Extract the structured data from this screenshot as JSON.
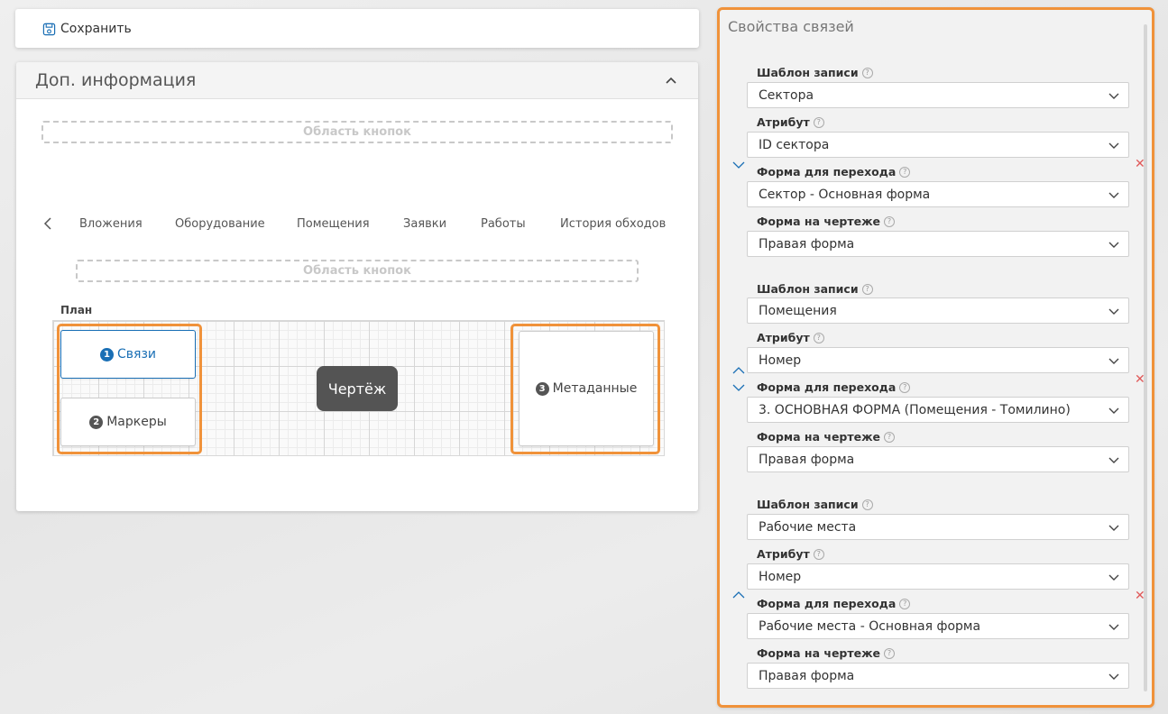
{
  "toolbar": {
    "save_label": "Сохранить"
  },
  "panel": {
    "title": "Доп. информация",
    "button_area_label": "Область кнопок",
    "tabs": [
      "Вложения",
      "Оборудование",
      "Помещения",
      "Заявки",
      "Работы",
      "История обходов"
    ],
    "plan_label": "План",
    "cards": {
      "links": {
        "num": "1",
        "label": "Связи"
      },
      "markers": {
        "num": "2",
        "label": "Маркеры"
      },
      "meta": {
        "num": "3",
        "label": "Метаданные"
      }
    },
    "drawing_label": "Чертёж"
  },
  "props": {
    "title": "Свойства связей",
    "labels": {
      "template": "Шаблон записи",
      "attribute": "Атрибут",
      "nav_form": "Форма для перехода",
      "drawing_form": "Форма на чертеже"
    },
    "help_glyph": "?",
    "delete_glyph": "✕",
    "groups": [
      {
        "template": "Сектора",
        "attribute": "ID сектора",
        "nav_form": "Сектор - Основная форма",
        "drawing_form": "Правая форма"
      },
      {
        "template": "Помещения",
        "attribute": "Номер",
        "nav_form": "3. ОСНОВНАЯ ФОРМА (Помещения - Томилино)",
        "drawing_form": "Правая форма"
      },
      {
        "template": "Рабочие места",
        "attribute": "Номер",
        "nav_form": "Рабочие места - Основная форма",
        "drawing_form": "Правая форма"
      }
    ]
  },
  "colors": {
    "accent_orange": "#f0923a",
    "link_blue": "#1a6fb5",
    "delete_red": "#e05a5a"
  },
  "icons": [
    "save-icon",
    "chevron-up-icon",
    "chevron-left-icon",
    "chevron-down-icon",
    "help-icon",
    "close-icon"
  ]
}
